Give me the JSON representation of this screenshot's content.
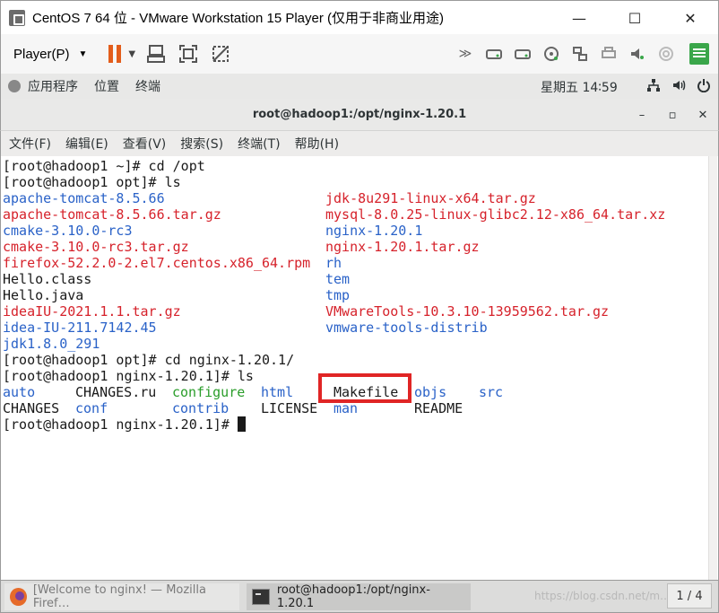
{
  "vmware": {
    "title": "CentOS 7 64 位 - VMware Workstation 15 Player (仅用于非商业用途)",
    "controls": {
      "minimize": "—",
      "maximize": "☐",
      "close": "✕"
    },
    "toolbar": {
      "player_menu": "Player(P)"
    }
  },
  "gnome": {
    "apps": "应用程序",
    "places": "位置",
    "terminal": "终端",
    "clock": "星期五 14∶59"
  },
  "terminal": {
    "title": "root@hadoop1:/opt/nginx-1.20.1",
    "controls": {
      "minimize": "–",
      "maximize": "▫",
      "close": "✕"
    },
    "menu": [
      "文件(F)",
      "编辑(E)",
      "查看(V)",
      "搜索(S)",
      "终端(T)",
      "帮助(H)"
    ],
    "prompt1": "[root@hadoop1 ~]# cd /opt",
    "prompt2": "[root@hadoop1 opt]# ls",
    "opt_listing": [
      {
        "left": "apache-tomcat-8.5.66",
        "left_color": "blue",
        "right": "jdk-8u291-linux-x64.tar.gz",
        "right_color": "red"
      },
      {
        "left": "apache-tomcat-8.5.66.tar.gz",
        "left_color": "red",
        "right": "mysql-8.0.25-linux-glibc2.12-x86_64.tar.xz",
        "right_color": "red"
      },
      {
        "left": "cmake-3.10.0-rc3",
        "left_color": "blue",
        "right": "nginx-1.20.1",
        "right_color": "blue"
      },
      {
        "left": "cmake-3.10.0-rc3.tar.gz",
        "left_color": "red",
        "right": "nginx-1.20.1.tar.gz",
        "right_color": "red"
      },
      {
        "left": "firefox-52.2.0-2.el7.centos.x86_64.rpm",
        "left_color": "red",
        "right": "rh",
        "right_color": "blue"
      },
      {
        "left": "Hello.class",
        "left_color": "black",
        "right": "tem",
        "right_color": "blue"
      },
      {
        "left": "Hello.java",
        "left_color": "black",
        "right": "tmp",
        "right_color": "blue"
      },
      {
        "left": "ideaIU-2021.1.1.tar.gz",
        "left_color": "red",
        "right": "VMwareTools-10.3.10-13959562.tar.gz",
        "right_color": "red"
      },
      {
        "left": "idea-IU-211.7142.45",
        "left_color": "blue",
        "right": "vmware-tools-distrib",
        "right_color": "blue"
      },
      {
        "left": "jdk1.8.0_291",
        "left_color": "blue",
        "right": "",
        "right_color": "black"
      }
    ],
    "prompt3": "[root@hadoop1 opt]# cd nginx-1.20.1/",
    "prompt4": "[root@hadoop1 nginx-1.20.1]# ls",
    "nginx_row1": [
      {
        "text": "auto",
        "color": "blue"
      },
      {
        "text": "CHANGES.ru",
        "color": "black"
      },
      {
        "text": "configure",
        "color": "green"
      },
      {
        "text": "html",
        "color": "blue"
      },
      {
        "text": "Makefile",
        "color": "black"
      },
      {
        "text": "objs",
        "color": "blue"
      },
      {
        "text": "src",
        "color": "blue"
      }
    ],
    "nginx_row2": [
      {
        "text": "CHANGES",
        "color": "black"
      },
      {
        "text": "conf",
        "color": "blue"
      },
      {
        "text": "contrib",
        "color": "blue"
      },
      {
        "text": "LICENSE",
        "color": "black"
      },
      {
        "text": "man",
        "color": "blue"
      },
      {
        "text": "README",
        "color": "black"
      }
    ],
    "prompt5": "[root@hadoop1 nginx-1.20.1]# "
  },
  "taskbar": {
    "task1": "[Welcome to nginx! — Mozilla Firef…",
    "task2": "root@hadoop1:/opt/nginx-1.20.1",
    "workspace": "1 / 4",
    "watermark": "https://blog.csdn.net/m…"
  }
}
